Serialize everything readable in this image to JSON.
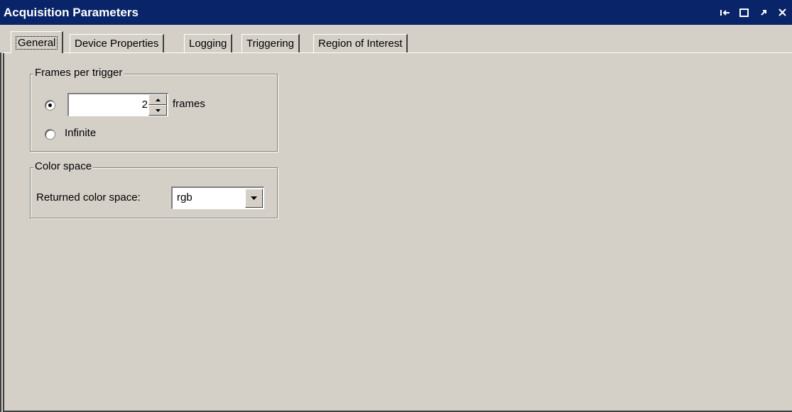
{
  "window": {
    "title": "Acquisition Parameters",
    "controls": [
      {
        "name": "undock-icon"
      },
      {
        "name": "maximize-icon"
      },
      {
        "name": "restore-icon"
      },
      {
        "name": "close-icon"
      }
    ],
    "title_bg": "#0a246a"
  },
  "tabs": [
    {
      "label": "General",
      "active": true
    },
    {
      "label": "Device Properties",
      "active": false
    },
    {
      "label": "Logging",
      "active": false
    },
    {
      "label": "Triggering",
      "active": false
    },
    {
      "label": "Region of Interest",
      "active": false
    }
  ],
  "frames_group": {
    "title": "Frames per trigger",
    "frames_value": "2",
    "frames_unit": "frames",
    "infinite_label": "Infinite",
    "selected": "frames"
  },
  "color_group": {
    "title": "Color space",
    "returned_label": "Returned color space:",
    "returned_value": "rgb"
  }
}
